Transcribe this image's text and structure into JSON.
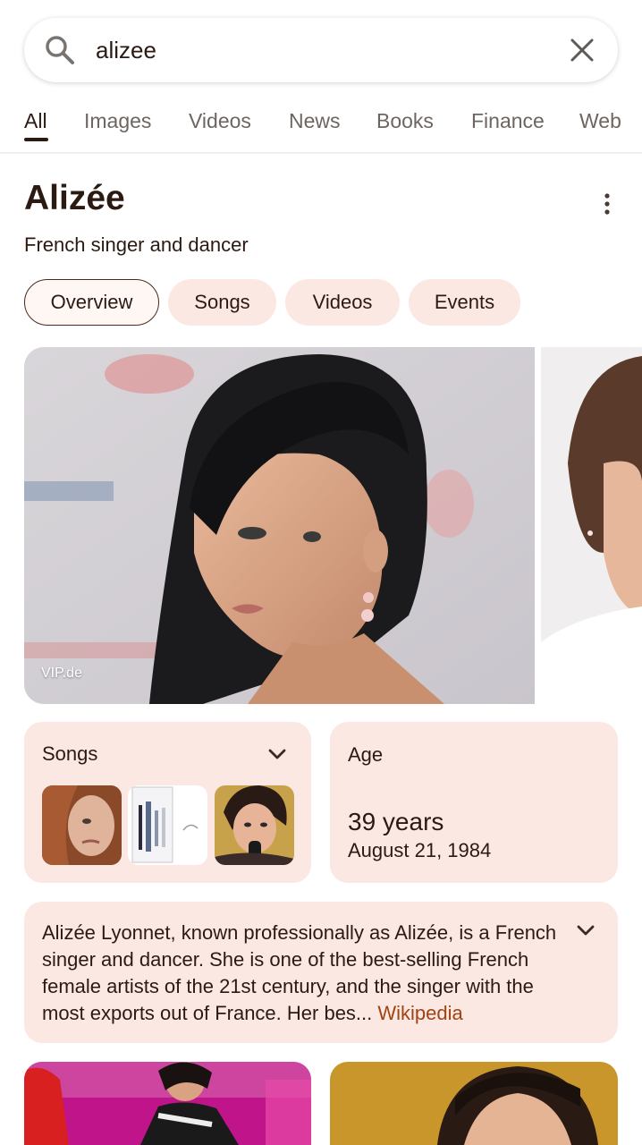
{
  "search": {
    "query": "alizee"
  },
  "tabs": [
    {
      "label": "All",
      "active": true
    },
    {
      "label": "Images"
    },
    {
      "label": "Videos"
    },
    {
      "label": "News"
    },
    {
      "label": "Books"
    },
    {
      "label": "Finance"
    },
    {
      "label": "Web"
    }
  ],
  "entity": {
    "title": "Alizée",
    "subtitle": "French singer and dancer"
  },
  "chips": [
    {
      "label": "Overview",
      "active": true
    },
    {
      "label": "Songs"
    },
    {
      "label": "Videos"
    },
    {
      "label": "Events"
    }
  ],
  "hero": {
    "source": "VIP.de"
  },
  "songs_card": {
    "title": "Songs"
  },
  "age_card": {
    "title": "Age",
    "value": "39 years",
    "date": "August 21, 1984"
  },
  "description": {
    "text": "Alizée Lyonnet, known professionally as Alizée, is a French singer and dancer. She is one of the best-selling French female artists of the 21st century, and the singer with the most exports out of France. Her bes...",
    "source_link": "Wikipedia"
  },
  "colors": {
    "accent": "#a04412",
    "card_bg": "#fce8e3",
    "text": "#2b1a12"
  }
}
